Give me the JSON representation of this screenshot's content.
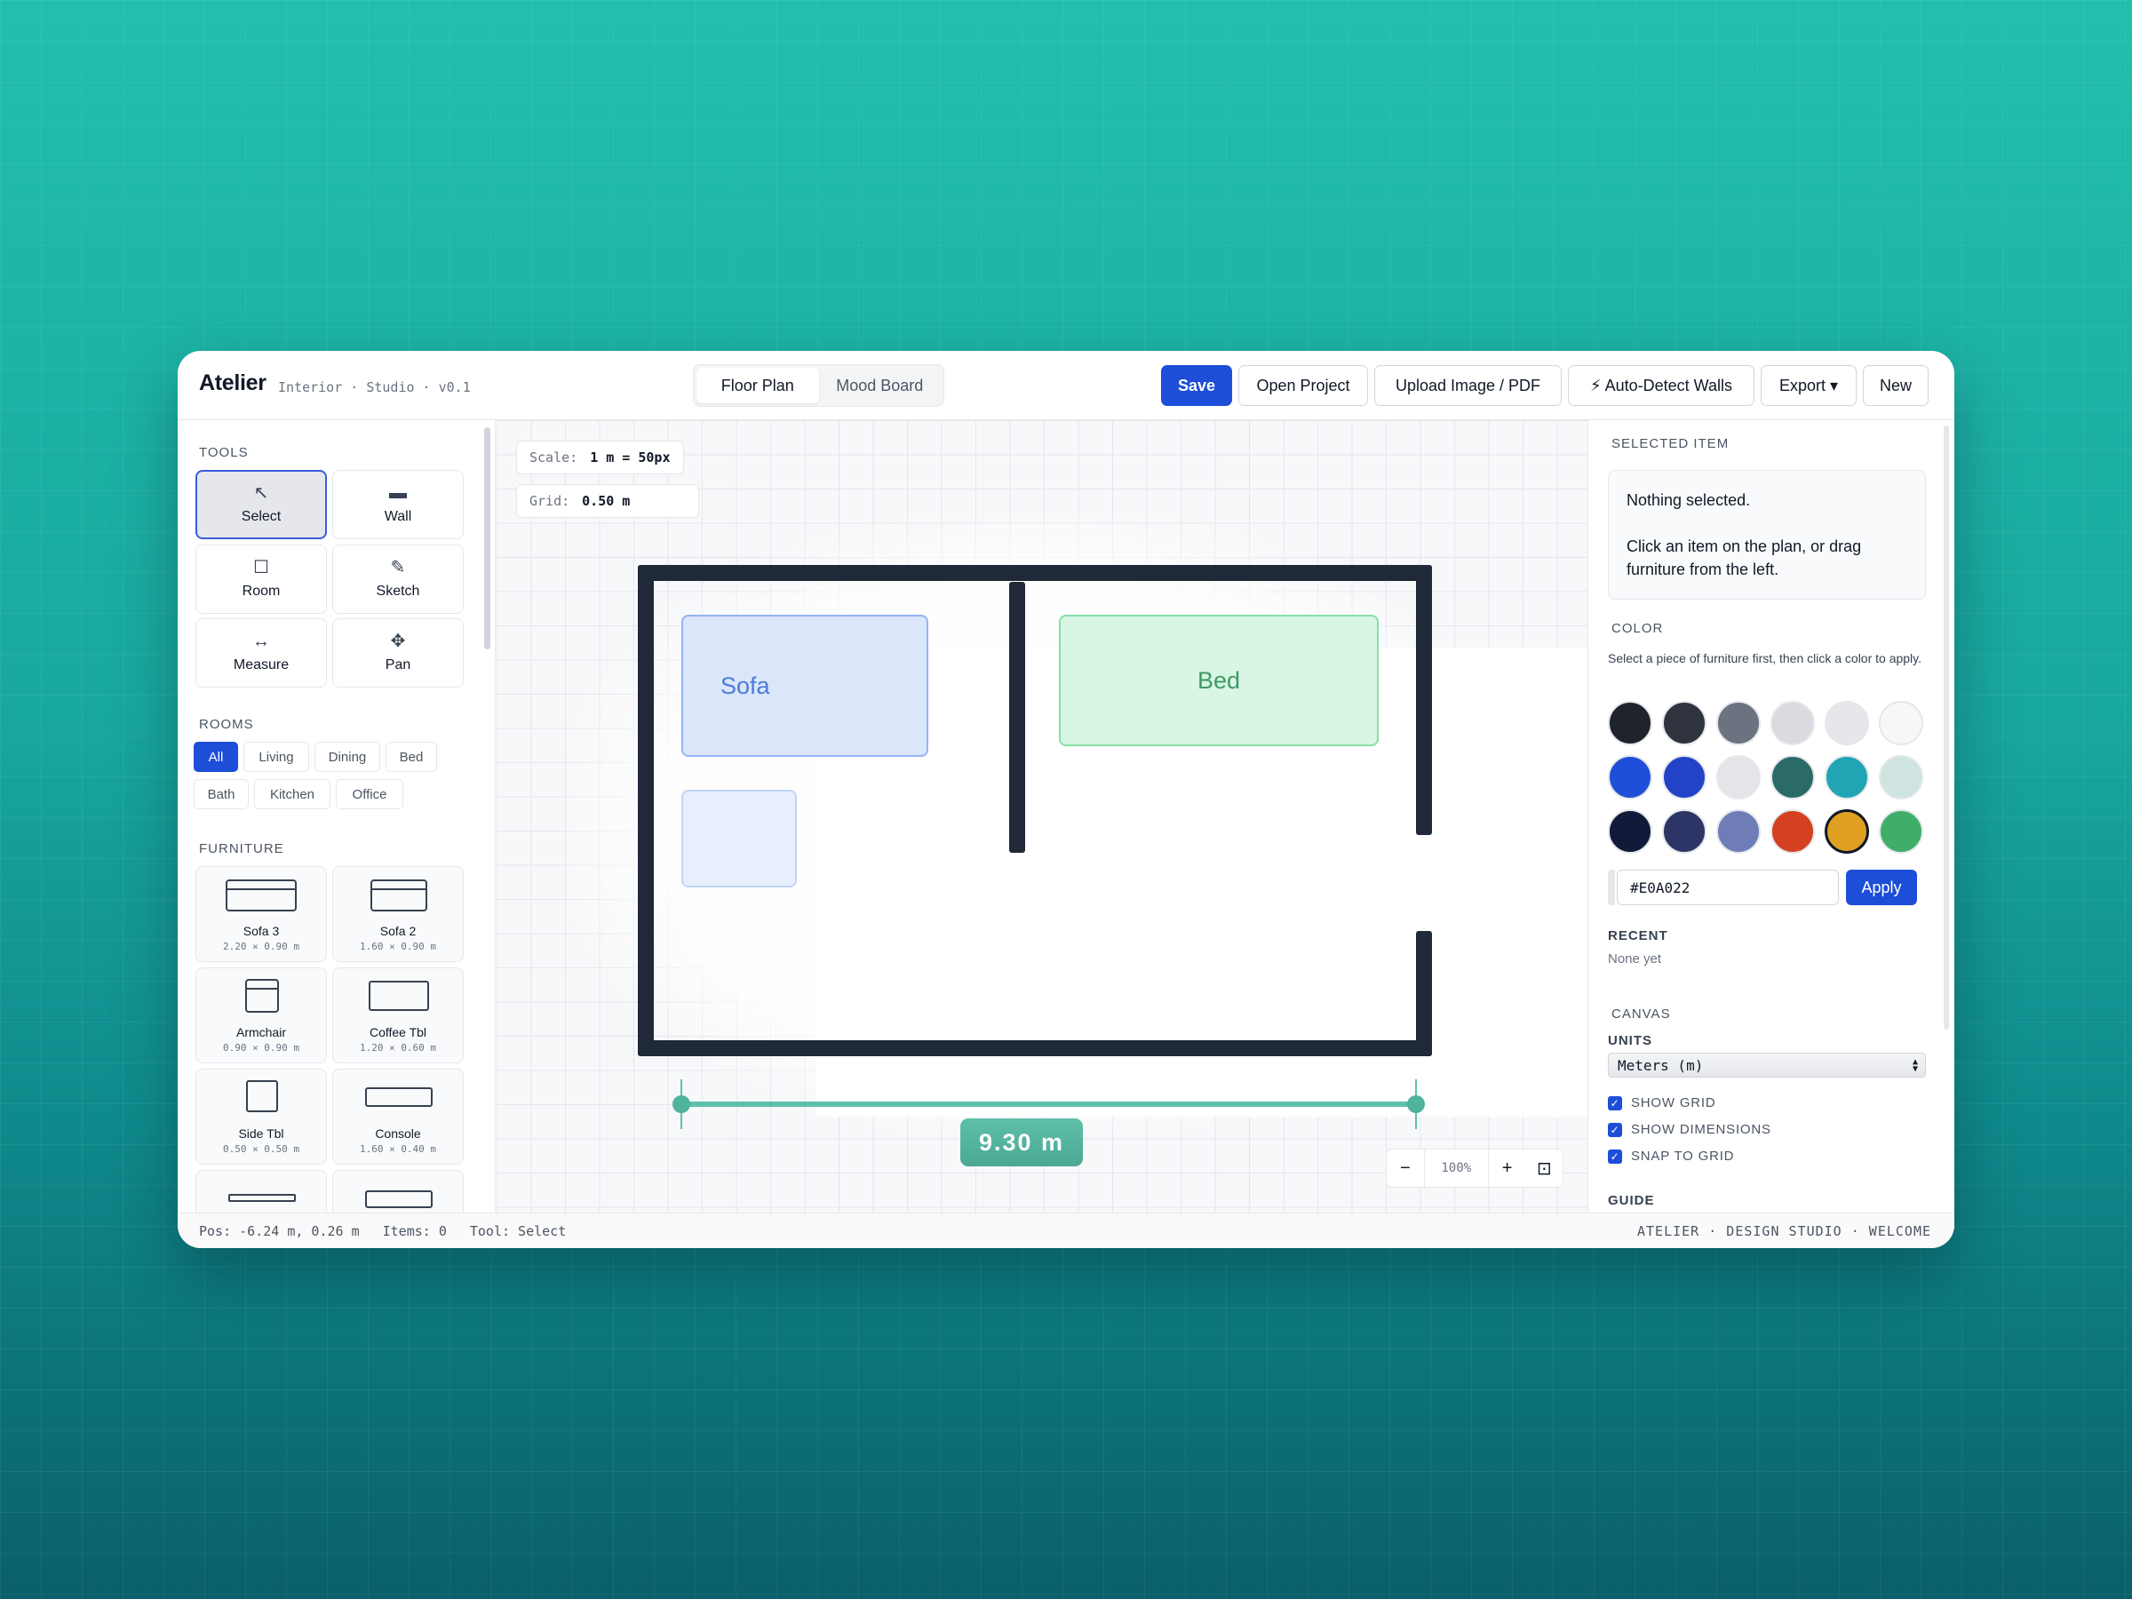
{
  "app": {
    "name": "Atelier",
    "subtitle": "Interior · Studio · v0.1"
  },
  "mode_tabs": [
    {
      "label": "Floor Plan",
      "active": true
    },
    {
      "label": "Mood Board",
      "active": false
    }
  ],
  "header_buttons": {
    "save": "Save",
    "open_project": "Open Project",
    "upload": "Upload Image / PDF",
    "auto_detect": "⚡ Auto-Detect Walls",
    "export": "Export ▾",
    "new": "New"
  },
  "tools": {
    "title": "TOOLS",
    "items": [
      {
        "label": "Select",
        "icon": "↖",
        "icon_name": "cursor-arrow-icon",
        "active": true
      },
      {
        "label": "Wall",
        "icon": "▬",
        "icon_name": "wall-icon",
        "active": false
      },
      {
        "label": "Room",
        "icon": "☐",
        "icon_name": "room-square-icon",
        "active": false
      },
      {
        "label": "Sketch",
        "icon": "✎",
        "icon_name": "pencil-icon",
        "active": false
      },
      {
        "label": "Measure",
        "icon": "↔",
        "icon_name": "measure-arrows-icon",
        "active": false
      },
      {
        "label": "Pan",
        "icon": "✥",
        "icon_name": "pan-move-icon",
        "active": false
      }
    ]
  },
  "rooms": {
    "title": "ROOMS",
    "filters": [
      {
        "label": "All",
        "active": true
      },
      {
        "label": "Living",
        "active": false
      },
      {
        "label": "Dining",
        "active": false
      },
      {
        "label": "Bed",
        "active": false
      },
      {
        "label": "Bath",
        "active": false
      },
      {
        "label": "Kitchen",
        "active": false
      },
      {
        "label": "Office",
        "active": false
      }
    ]
  },
  "furniture": {
    "title": "FURNITURE",
    "items": [
      {
        "name": "Sofa 3",
        "dims": "2.20 × 0.90 m"
      },
      {
        "name": "Sofa 2",
        "dims": "1.60 × 0.90 m"
      },
      {
        "name": "Armchair",
        "dims": "0.90 × 0.90 m"
      },
      {
        "name": "Coffee Tbl",
        "dims": "1.20 × 0.60 m"
      },
      {
        "name": "Side Tbl",
        "dims": "0.50 × 0.50 m"
      },
      {
        "name": "Console",
        "dims": "1.60 × 0.40 m"
      }
    ]
  },
  "canvas": {
    "scale_label": "Scale:",
    "scale_value": "1 m = 50px",
    "grid_label": "Grid:",
    "grid_value": "0.50 m",
    "placed": [
      {
        "label": "Sofa"
      },
      {
        "label": "Bed"
      },
      {
        "label": ""
      }
    ],
    "measurement": "9.30 m",
    "zoom": {
      "minus": "−",
      "value": "100%",
      "plus": "+",
      "fit": "⊡"
    }
  },
  "inspector": {
    "selected_title": "SELECTED ITEM",
    "nothing": "Nothing selected.",
    "hint": "Click an item on the plan, or drag furniture from the left.",
    "color_title": "COLOR",
    "color_hint": "Select a piece of furniture first, then click a color to apply.",
    "swatches": [
      "#1f232b",
      "#2e333d",
      "#6b7280",
      "#d9dbe0",
      "#e6e7ea",
      "#f6f7f8",
      "#1f4fd8",
      "#2242c7",
      "#e3e5e9",
      "#2a6b68",
      "#21a4b4",
      "#cfe4e1",
      "#121a3a",
      "#2c3566",
      "#6f7db7",
      "#d44120",
      "#e0a022",
      "#3fae6a"
    ],
    "selected_swatch": "#E0A022",
    "hex_value": "#E0A022",
    "apply": "Apply",
    "recent_title": "RECENT",
    "recent_empty": "None yet",
    "canvas_title": "CANVAS",
    "units_title": "UNITS",
    "units_value": "Meters (m)",
    "options": [
      {
        "label": "SHOW GRID",
        "checked": true
      },
      {
        "label": "SHOW DIMENSIONS",
        "checked": true
      },
      {
        "label": "SNAP TO GRID",
        "checked": true
      }
    ],
    "guide_title": "GUIDE"
  },
  "status": {
    "pos": "Pos: -6.24 m, 0.26 m",
    "items": "Items: 0",
    "tool": "Tool: Select",
    "right": "ATELIER · DESIGN STUDIO · WELCOME"
  },
  "colors": {
    "accent": "#1d4ed8",
    "wall": "#1f2937",
    "measure": "#5fc0a8"
  }
}
